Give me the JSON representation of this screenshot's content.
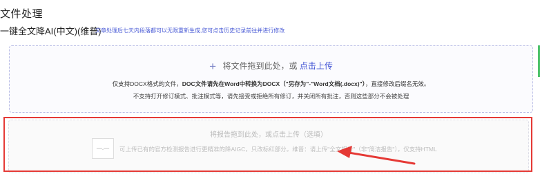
{
  "page": {
    "title": "文件处理",
    "subtitle": "一键全文降AI(中文)(维普)",
    "notice": "文章处理后七天内段落都可以无限重新生成,您可点击历史记录前往并进行修改"
  },
  "upload": {
    "plus_icon": "+",
    "prompt": "将文件拖到此处，或",
    "link": "点击上传",
    "info_line1_a": "仅支持DOCX格式的文件，",
    "info_line1_b": "DOC文件请先在Word中转换为DOCX（\"另存为\"-\"Word文档(.docx)\"）",
    "info_line1_c": "，直接修改后缀名无效。",
    "info_line2": "不支持打开修订模式、批注模式等，请先接受或拒绝所有修订，并关闭所有批注，否则这些部分不会被处理"
  },
  "report": {
    "title": "将报告拖到此处，或点击上传（选填）",
    "icon_label": "—.—",
    "desc": "可上传已有的官方检测报告进行更精准的降AIGC，只改标红部分。维普：请上传\"全文报告\"（非\"简洁报告\"），仅支持HTML"
  },
  "colors": {
    "accent": "#3c4fd3",
    "highlight": "#e53935",
    "sidebar_accent": "#4cc26a"
  }
}
